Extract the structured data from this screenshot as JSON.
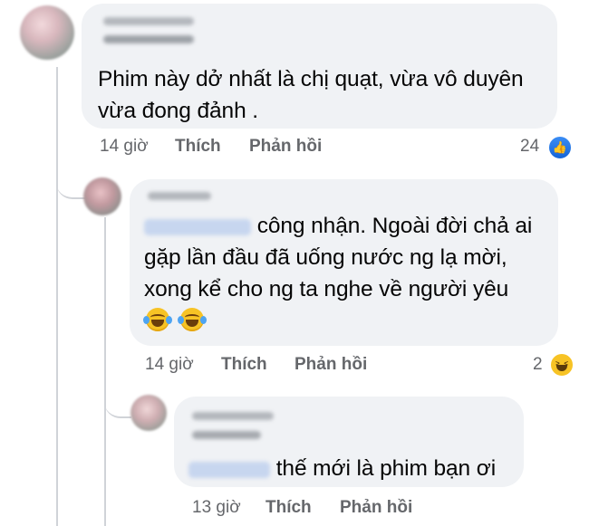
{
  "comments": [
    {
      "text_line1": "Phim này dở nhất là chị quạt, vừa vô duyên",
      "text_line2": "vừa đong đảnh .",
      "time": "14 giờ",
      "like_label": "Thích",
      "reply_label": "Phản hồi",
      "reaction_count": "24",
      "reaction_icon": "like-icon",
      "reaction_color": "#1877f2"
    },
    {
      "text_line1": "công nhận. Ngoài đời chả ai",
      "text_line2": "gặp lần đầu đã uống nước ng lạ mời,",
      "text_line3": "xong kể cho ng ta nghe về người yêu",
      "time": "14 giờ",
      "like_label": "Thích",
      "reply_label": "Phản hồi",
      "reaction_count": "2",
      "reaction_icon": "haha-icon",
      "reaction_color": "#f7c325"
    },
    {
      "text": "thế mới là phim bạn ơi",
      "time": "13 giờ",
      "like_label": "Thích",
      "reply_label": "Phản hồi"
    }
  ],
  "colors": {
    "bubble": "#f0f2f5",
    "meta_text": "#65676b",
    "mention": "#1877f2"
  }
}
